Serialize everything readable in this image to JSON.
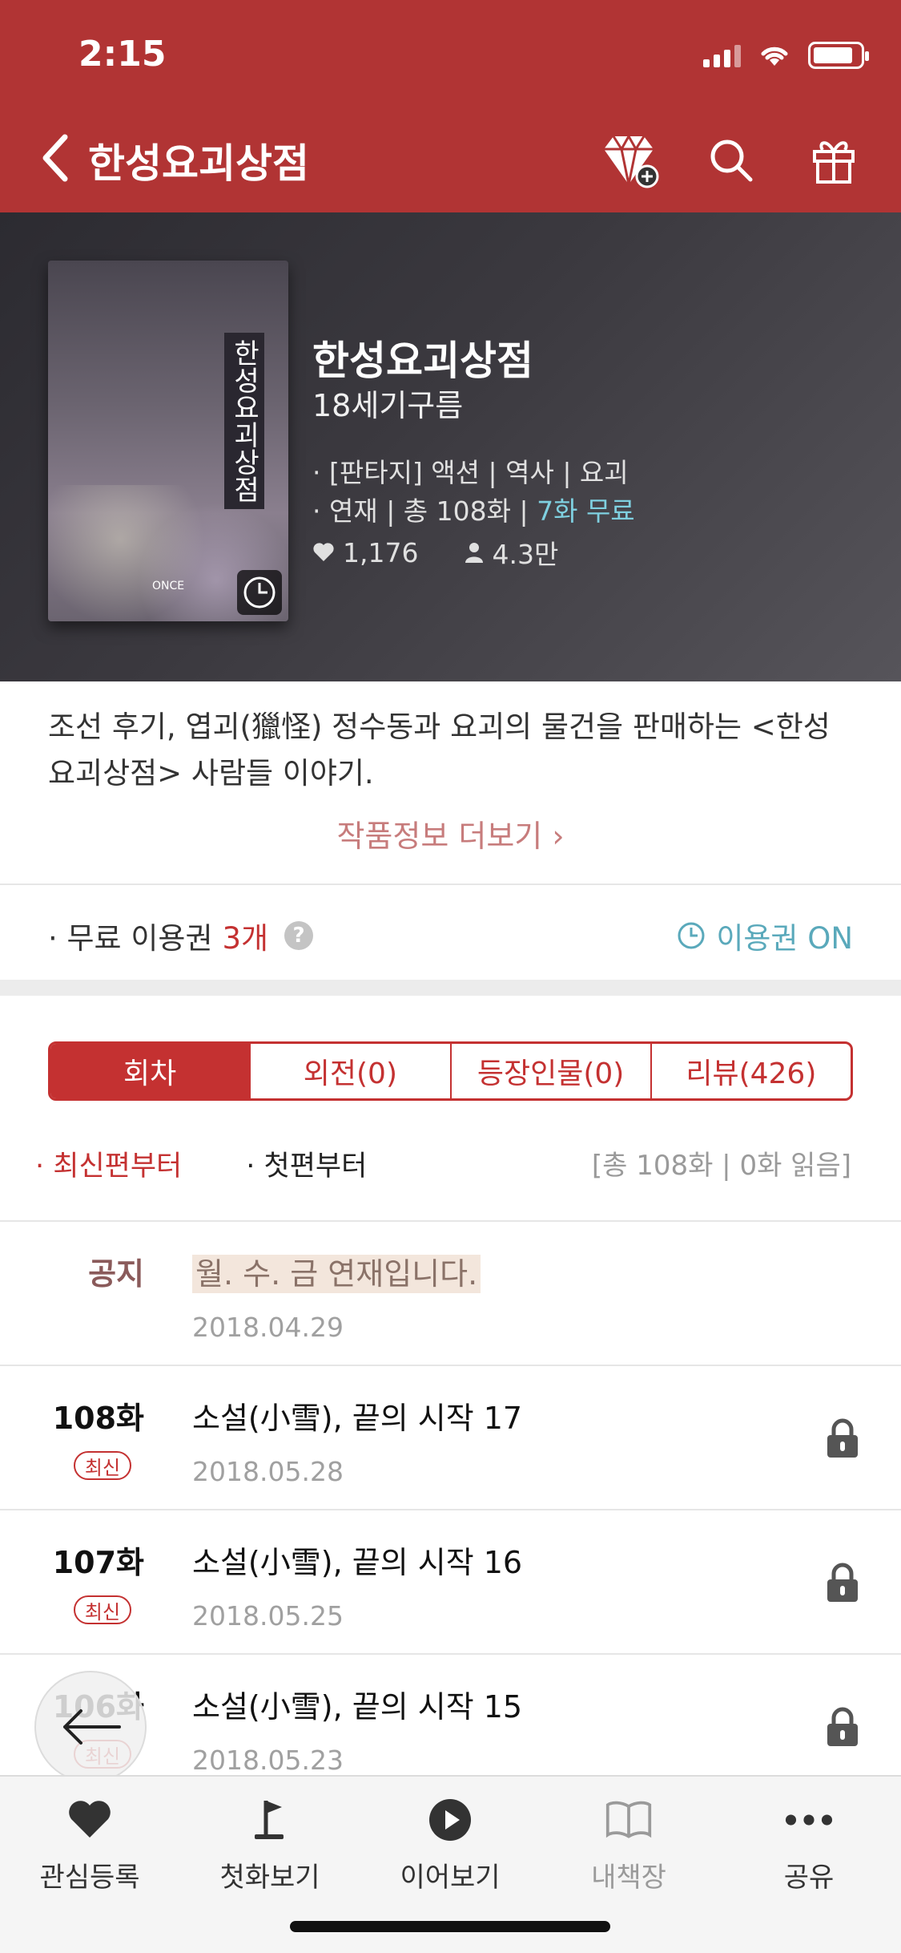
{
  "status_bar": {
    "time": "2:15"
  },
  "nav": {
    "title": "한성요괴상점"
  },
  "book": {
    "title": "한성요괴상점",
    "author": "18세기구름",
    "genre_line": "· [판타지] 액션 | 역사 | 요괴",
    "serial_prefix": "· 연재 | 총 108화 | ",
    "free_episodes": "7화 무료",
    "likes": "1,176",
    "readers": "4.3만",
    "cover_title": "한성요괴상점",
    "cover_brand": "ONCE"
  },
  "description": "조선 후기, 엽괴(獵怪) 정수동과 요괴의 물건을 판매하는 <한성요괴상점> 사람들 이야기.",
  "more_info": "작품정보 더보기 ›",
  "coupon": {
    "label": "· 무료 이용권",
    "count": "3개",
    "help": "?",
    "status": "이용권 ON"
  },
  "tabs": [
    {
      "label": "회차",
      "active": true
    },
    {
      "label": "외전(0)",
      "active": false
    },
    {
      "label": "등장인물(0)",
      "active": false
    },
    {
      "label": "리뷰(426)",
      "active": false
    }
  ],
  "sort": {
    "newest": "· 최신편부터",
    "first": "· 첫편부터",
    "total": "[총 108화 | 0화 읽음]"
  },
  "notice": {
    "label": "공지",
    "title": "월. 수. 금 연재입니다.",
    "date": "2018.04.29"
  },
  "episodes": [
    {
      "number": "108화",
      "badge": "최신",
      "title": "소설(小雪), 끝의 시작 17",
      "date": "2018.05.28"
    },
    {
      "number": "107화",
      "badge": "최신",
      "title": "소설(小雪), 끝의 시작 16",
      "date": "2018.05.25"
    },
    {
      "number": "106화",
      "badge": "최신",
      "title": "소설(小雪), 끝의 시작 15",
      "date": "2018.05.23"
    }
  ],
  "bottom_bar": [
    {
      "label": "관심등록",
      "icon": "heart-icon"
    },
    {
      "label": "첫화보기",
      "icon": "flag-icon"
    },
    {
      "label": "이어보기",
      "icon": "play-icon"
    },
    {
      "label": "내책장",
      "icon": "book-icon"
    },
    {
      "label": "공유",
      "icon": "more-icon"
    }
  ],
  "colors": {
    "brand": "#b13434",
    "accent": "#c43131",
    "teal": "#5aa9bb"
  }
}
